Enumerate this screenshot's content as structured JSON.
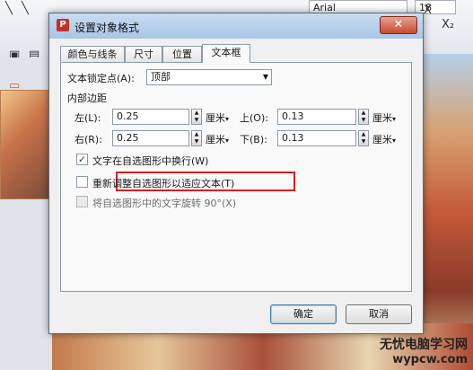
{
  "background": {
    "font_name": "Arial",
    "font_size": "18",
    "watermark_line1": "无忧电脑学习网",
    "watermark_line2": "wypcw.com"
  },
  "dialog": {
    "title": "设置对象格式",
    "app_icon": "P",
    "close_label": "✕",
    "tabs": [
      {
        "label": "颜色与线条",
        "active": false
      },
      {
        "label": "尺寸",
        "active": false
      },
      {
        "label": "位置",
        "active": false
      },
      {
        "label": "文本框",
        "active": true
      }
    ],
    "anchor": {
      "label": "文本锁定点(A):",
      "value": "顶部"
    },
    "margins": {
      "section_label": "内部边距",
      "left": {
        "label": "左(L):",
        "value": "0.25",
        "unit": "厘米"
      },
      "top": {
        "label": "上(O):",
        "value": "0.13",
        "unit": "厘米"
      },
      "right": {
        "label": "右(R):",
        "value": "0.25",
        "unit": "厘米"
      },
      "bottom": {
        "label": "下(B):",
        "value": "0.13",
        "unit": "厘米"
      }
    },
    "options": [
      {
        "label": "文字在自选图形中换行(W)",
        "checked": true,
        "enabled": true
      },
      {
        "label": "重新调整自选图形以适应文本(T)",
        "checked": false,
        "enabled": true
      },
      {
        "label": "将自选图形中的文字旋转 90°(X)",
        "checked": false,
        "enabled": false
      }
    ],
    "ok_label": "确定",
    "cancel_label": "取消"
  },
  "colors": {
    "title_bar": "#a9c5e6",
    "close_button": "#c64a2e",
    "highlight_box": "#d62020"
  },
  "icons": [
    "app-icon",
    "close-icon",
    "dropdown-arrow-icon",
    "spin-up-icon",
    "spin-down-icon",
    "check-icon"
  ]
}
